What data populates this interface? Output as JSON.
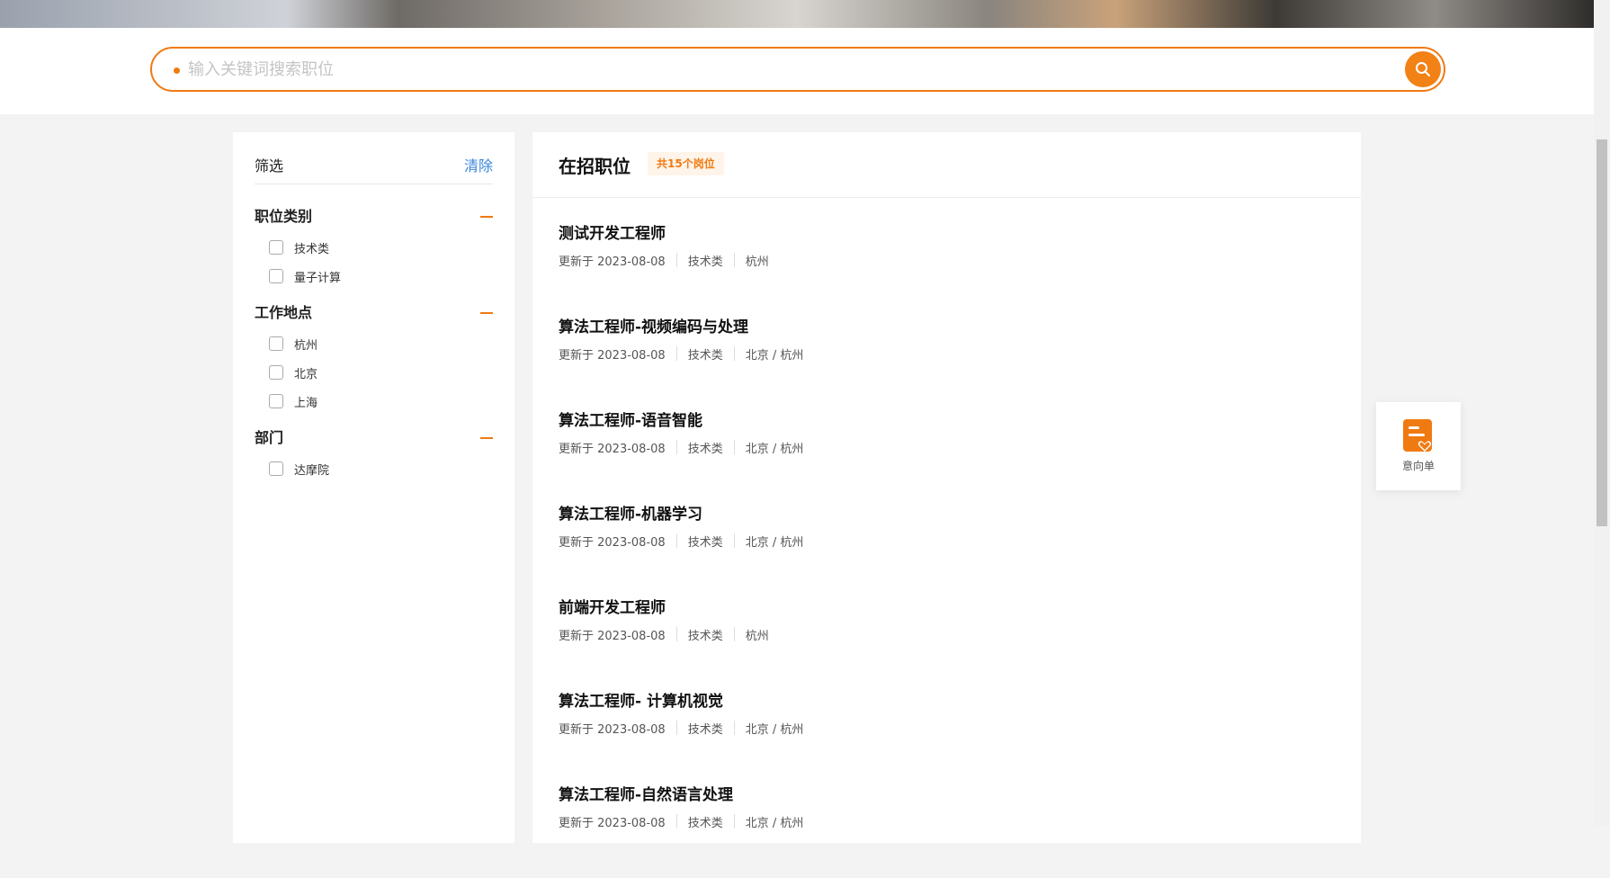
{
  "search": {
    "placeholder": "输入关键词搜索职位"
  },
  "filter": {
    "title": "筛选",
    "clear_label": "清除",
    "groups": [
      {
        "title": "职位类别",
        "options": [
          "技术类",
          "量子计算"
        ]
      },
      {
        "title": "工作地点",
        "options": [
          "杭州",
          "北京",
          "上海"
        ]
      },
      {
        "title": "部门",
        "options": [
          "达摩院"
        ]
      }
    ]
  },
  "jobs": {
    "title": "在招职位",
    "count_badge": "共15个岗位",
    "items": [
      {
        "title": "测试开发工程师",
        "updated": "更新于 2023-08-08",
        "category": "技术类",
        "location": "杭州"
      },
      {
        "title": "算法工程师-视频编码与处理",
        "updated": "更新于 2023-08-08",
        "category": "技术类",
        "location": "北京 / 杭州"
      },
      {
        "title": "算法工程师-语音智能",
        "updated": "更新于 2023-08-08",
        "category": "技术类",
        "location": "北京 / 杭州"
      },
      {
        "title": "算法工程师-机器学习",
        "updated": "更新于 2023-08-08",
        "category": "技术类",
        "location": "北京 / 杭州"
      },
      {
        "title": "前端开发工程师",
        "updated": "更新于 2023-08-08",
        "category": "技术类",
        "location": "杭州"
      },
      {
        "title": "算法工程师- 计算机视觉",
        "updated": "更新于 2023-08-08",
        "category": "技术类",
        "location": "北京 / 杭州"
      },
      {
        "title": "算法工程师-自然语言处理",
        "updated": "更新于 2023-08-08",
        "category": "技术类",
        "location": "北京 / 杭州"
      }
    ]
  },
  "wishlist": {
    "label": "意向单"
  },
  "colors": {
    "accent": "#f07a12",
    "link": "#3a86d8"
  },
  "icons": {
    "search": "search-icon",
    "wishlist": "wishlist-heart-icon"
  }
}
